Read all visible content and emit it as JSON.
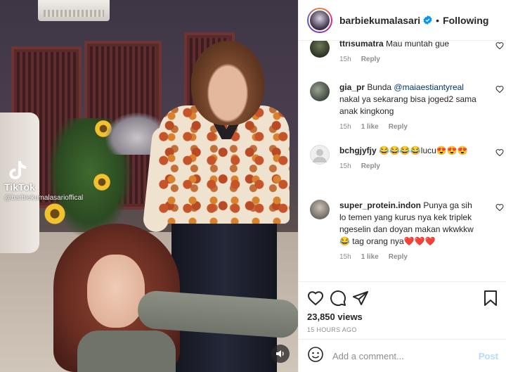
{
  "video": {
    "watermark_brand": "TikTok",
    "watermark_handle": "@barbiekumalasarioffical"
  },
  "header": {
    "username": "barbiekumalasari",
    "separator": "•",
    "follow_label": "Following"
  },
  "comments": [
    {
      "username": "ttrisumatra",
      "text": "Mau muntah gue",
      "time": "15h",
      "likes": "",
      "reply": "Reply"
    },
    {
      "username": "gia_pr",
      "text_before": "Bunda ",
      "mention": "@maiaestiantyreal",
      "text_after": " nakal ya sekarang bisa joged2 sama anak kingkong",
      "time": "15h",
      "likes": "1 like",
      "reply": "Reply"
    },
    {
      "username": "bchgjyfjy",
      "text": "😂😂😂😂lucu😍😍😍",
      "time": "15h",
      "likes": "",
      "reply": "Reply"
    },
    {
      "username": "super_protein.indon",
      "text": "Punya ga sih lo temen yang kurus nya kek triplek ngeselin dan doyan makan wkwkkw😂 tag orang nya❤️❤️❤️",
      "time": "15h",
      "likes": "1 like",
      "reply": "Reply"
    }
  ],
  "post": {
    "views": "23,850 views",
    "timestamp": "15 HOURS AGO"
  },
  "composer": {
    "placeholder": "Add a comment...",
    "post_label": "Post"
  },
  "colors": {
    "verified": "#0095f6",
    "link": "#00376b",
    "post_disabled": "#b3dbff",
    "meta_gray": "#8e8e8e"
  }
}
